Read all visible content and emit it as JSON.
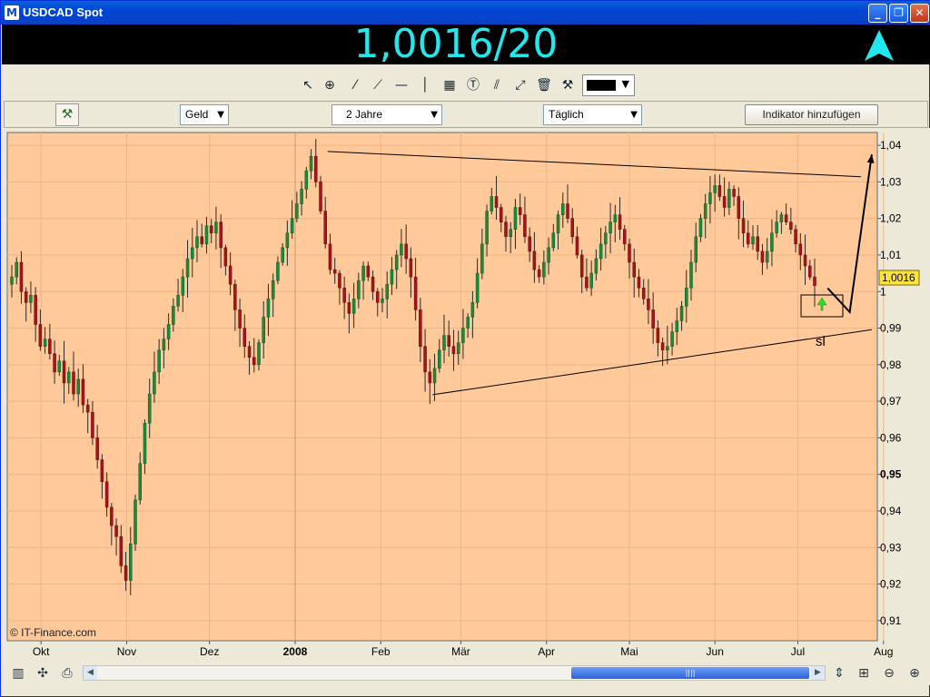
{
  "window": {
    "title": "USDCAD Spot",
    "app_icon": "M",
    "buttons": {
      "minimize": "_",
      "maximize": "❐",
      "close": "✕"
    }
  },
  "price": {
    "value": "1,0016/20",
    "trend_icon": "up-arrow-icon",
    "color": "#22e8ee"
  },
  "toolbar": {
    "tools": [
      "cursor-icon",
      "zoom-in-icon",
      "line-icon",
      "trendline-icon",
      "horizontal-line-icon",
      "vertical-line-icon",
      "chart-edit-icon",
      "text-icon",
      "parallel-lines-icon",
      "arrows-icon",
      "trash-icon",
      "tools-icon"
    ],
    "line_color": "#000000"
  },
  "options": {
    "price_type": "Geld",
    "period": "2 Jahre",
    "interval": "Täglich",
    "add_indicator_label": "Indikator hinzufügen"
  },
  "chart_data": {
    "type": "candlestick",
    "background": "#ffc99a",
    "x_labels": [
      "Okt",
      "Nov",
      "Dez",
      "2008",
      "Feb",
      "Mär",
      "Apr",
      "Mai",
      "Jun",
      "Jul",
      "Aug"
    ],
    "y_ticks": [
      "1,04",
      "1,03",
      "1,02",
      "1,01",
      "1",
      "0,99",
      "0,98",
      "0,97",
      "0,96",
      "0,95",
      "0,94",
      "0,93",
      "0,92",
      "0,91"
    ],
    "y_tick_values": [
      1.04,
      1.03,
      1.02,
      1.01,
      1.0,
      0.99,
      0.98,
      0.97,
      0.96,
      0.95,
      0.94,
      0.93,
      0.92,
      0.91
    ],
    "ylim": [
      0.9045,
      1.0435
    ],
    "current_price_label": "1,0016",
    "current_price": 1.0016,
    "copyright": "© IT-Finance.com",
    "annotation_text": "sl",
    "closes": [
      1.004,
      1.008,
      1.0,
      0.997,
      0.999,
      0.991,
      0.985,
      0.987,
      0.983,
      0.978,
      0.981,
      0.975,
      0.978,
      0.972,
      0.976,
      0.969,
      0.967,
      0.96,
      0.954,
      0.948,
      0.941,
      0.936,
      0.933,
      0.925,
      0.921,
      0.931,
      0.943,
      0.953,
      0.964,
      0.972,
      0.978,
      0.984,
      0.987,
      0.991,
      0.996,
      0.999,
      1.004,
      1.009,
      1.012,
      1.015,
      1.013,
      1.018,
      1.016,
      1.019,
      1.012,
      1.007,
      1.002,
      0.995,
      0.99,
      0.985,
      0.982,
      0.98,
      0.986,
      0.993,
      0.998,
      1.003,
      1.008,
      1.012,
      1.016,
      1.02,
      1.024,
      1.028,
      1.033,
      1.037,
      1.03,
      1.022,
      1.013,
      1.006,
      1.005,
      1.001,
      0.997,
      0.994,
      0.998,
      1.003,
      1.007,
      1.004,
      1.0,
      0.997,
      0.998,
      1.002,
      1.006,
      1.01,
      1.013,
      1.009,
      1.004,
      0.995,
      0.985,
      0.978,
      0.975,
      0.979,
      0.984,
      0.988,
      0.985,
      0.983,
      0.986,
      0.99,
      0.993,
      0.997,
      1.005,
      1.013,
      1.022,
      1.026,
      1.023,
      1.019,
      1.015,
      1.017,
      1.023,
      1.021,
      1.015,
      1.011,
      1.006,
      1.004,
      1.008,
      1.012,
      1.016,
      1.021,
      1.024,
      1.02,
      1.015,
      1.01,
      1.004,
      1.001,
      1.005,
      1.009,
      1.013,
      1.016,
      1.019,
      1.021,
      1.017,
      1.013,
      1.008,
      1.004,
      1.001,
      0.998,
      0.995,
      0.99,
      0.986,
      0.984,
      0.985,
      0.989,
      0.992,
      0.996,
      1.001,
      1.008,
      1.015,
      1.02,
      1.024,
      1.027,
      1.029,
      1.026,
      1.023,
      1.028,
      1.026,
      1.02,
      1.016,
      1.013,
      1.015,
      1.011,
      1.008,
      1.011,
      1.016,
      1.019,
      1.021,
      1.019,
      1.017,
      1.013,
      1.01,
      1.007,
      1.004,
      1.0016
    ],
    "lines": [
      {
        "name": "upper-trendline",
        "x": [
          "2008-01-21",
          "2008-08-01"
        ],
        "y": [
          1.0383,
          1.0314
        ]
      },
      {
        "name": "lower-trendline",
        "x": [
          "2008-02-28",
          "2008-08-05"
        ],
        "y": [
          0.9718,
          0.9896
        ]
      },
      {
        "name": "projection-arrow",
        "x": [
          "2008-07-20",
          "2008-07-28",
          "2008-08-05"
        ],
        "y": [
          1.0009,
          0.9944,
          1.0375
        ]
      }
    ],
    "grid": true,
    "legend": "none"
  },
  "bottom": {
    "tools": [
      "chart-type-icon",
      "crosshair-icon",
      "print-icon"
    ],
    "right_tools": [
      "fit-icon",
      "zoom-frame-icon",
      "zoom-out-icon",
      "zoom-in-icon"
    ],
    "scroll_grip": "||||"
  }
}
